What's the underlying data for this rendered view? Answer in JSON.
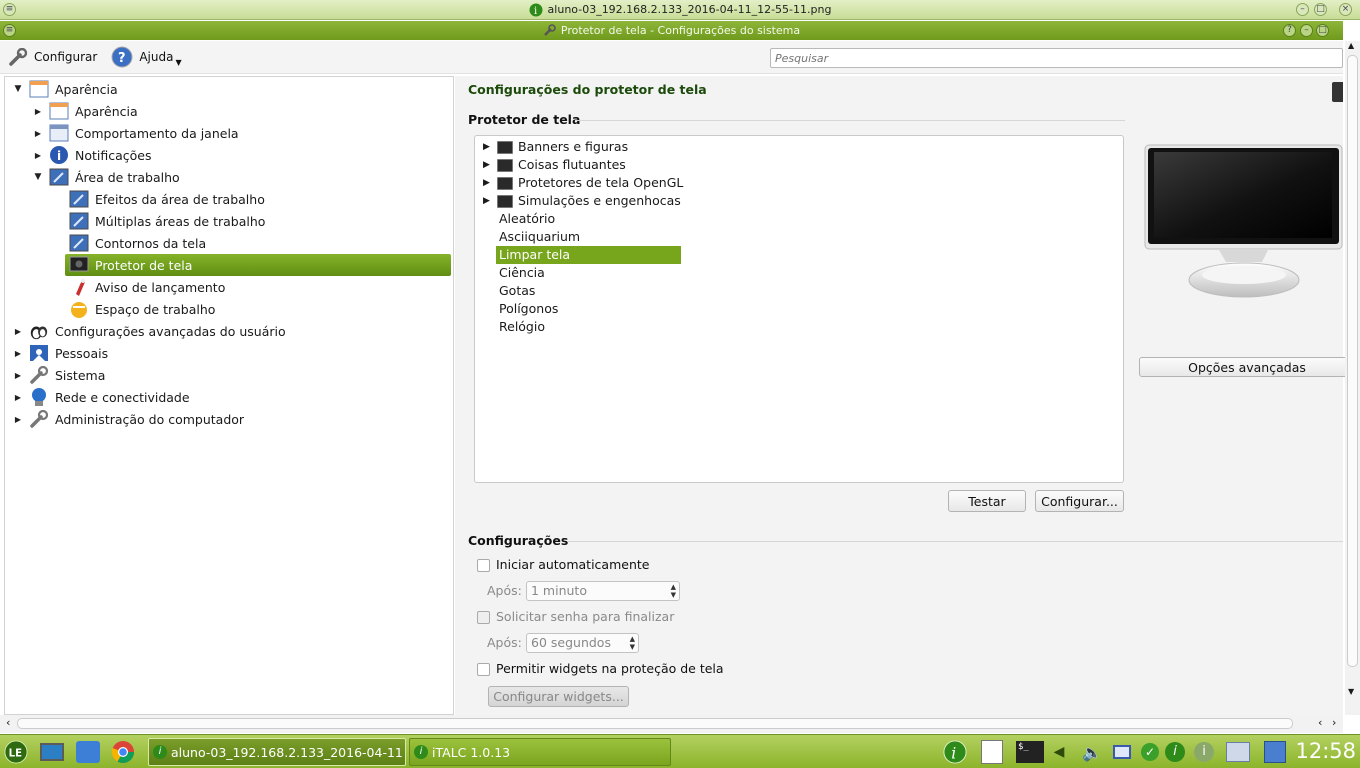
{
  "outer_window": {
    "title": "aluno-03_192.168.2.133_2016-04-11_12-55-11.png"
  },
  "app_window": {
    "title": "Protetor de tela - Configurações do sistema"
  },
  "toolbar": {
    "configure_label": "Configurar",
    "help_label": "Ajuda",
    "search_placeholder": "Pesquisar"
  },
  "tree": {
    "items": [
      {
        "label": "Aparência",
        "level": 0,
        "expanded": true,
        "icon": "appearance-icon"
      },
      {
        "label": "Aparência",
        "level": 1,
        "expanded": false,
        "icon": "appearance-icon"
      },
      {
        "label": "Comportamento da janela",
        "level": 1,
        "expanded": false,
        "icon": "window-icon"
      },
      {
        "label": "Notificações",
        "level": 1,
        "expanded": false,
        "icon": "info-icon"
      },
      {
        "label": "Área de trabalho",
        "level": 1,
        "expanded": true,
        "icon": "desktop-icon"
      },
      {
        "label": "Efeitos da área de trabalho",
        "level": 2,
        "icon": "desktop-icon"
      },
      {
        "label": "Múltiplas áreas de trabalho",
        "level": 2,
        "icon": "desktop-icon"
      },
      {
        "label": "Contornos da tela",
        "level": 2,
        "icon": "desktop-icon"
      },
      {
        "label": "Protetor de tela",
        "level": 2,
        "icon": "screensaver-icon",
        "selected": true
      },
      {
        "label": "Aviso de lançamento",
        "level": 2,
        "icon": "rocket-icon"
      },
      {
        "label": "Espaço de trabalho",
        "level": 2,
        "icon": "workspace-icon"
      },
      {
        "label": "Configurações avançadas do usuário",
        "level": 0,
        "expanded": false,
        "icon": "users-icon"
      },
      {
        "label": "Pessoais",
        "level": 0,
        "expanded": false,
        "icon": "personal-icon"
      },
      {
        "label": "Sistema",
        "level": 0,
        "expanded": false,
        "icon": "wrench-icon"
      },
      {
        "label": "Rede e conectividade",
        "level": 0,
        "expanded": false,
        "icon": "network-icon"
      },
      {
        "label": "Administração do computador",
        "level": 0,
        "expanded": false,
        "icon": "wrench-icon"
      }
    ]
  },
  "main": {
    "title": "Configurações do protetor de tela",
    "screensaver_section": "Protetor de tela",
    "screensavers": [
      {
        "label": "Banners e figuras",
        "group": true
      },
      {
        "label": "Coisas flutuantes",
        "group": true
      },
      {
        "label": "Protetores de tela OpenGL",
        "group": true
      },
      {
        "label": "Simulações e engenhocas",
        "group": true
      },
      {
        "label": "Aleatório",
        "group": false
      },
      {
        "label": "Asciiquarium",
        "group": false
      },
      {
        "label": "Limpar tela",
        "group": false,
        "selected": true
      },
      {
        "label": "Ciência",
        "group": false
      },
      {
        "label": "Gotas",
        "group": false
      },
      {
        "label": "Polígonos",
        "group": false
      },
      {
        "label": "Relógio",
        "group": false
      }
    ],
    "advanced_button": "Opções avançadas",
    "test_button": "Testar",
    "configure_button": "Configurar...",
    "settings_section": "Configurações",
    "auto_start_label": "Iniciar automaticamente",
    "after_label_1": "Após:",
    "after_value_1": "1 minuto",
    "require_password_label": "Solicitar senha para finalizar",
    "after_label_2": "Após:",
    "after_value_2": "60 segundos",
    "allow_widgets_label": "Permitir widgets na proteção de tela",
    "configure_widgets_button": "Configurar widgets..."
  },
  "taskbar": {
    "tasks": [
      {
        "label": "aluno-03_192.168.2.133_2016-04-11",
        "active": true
      },
      {
        "label": "iTALC 1.0.13",
        "active": false
      }
    ],
    "clock": "12:58"
  },
  "colors": {
    "accent": "#77a51c",
    "title_green": "#1b4a0a",
    "taskbar": "#9cc23d"
  }
}
